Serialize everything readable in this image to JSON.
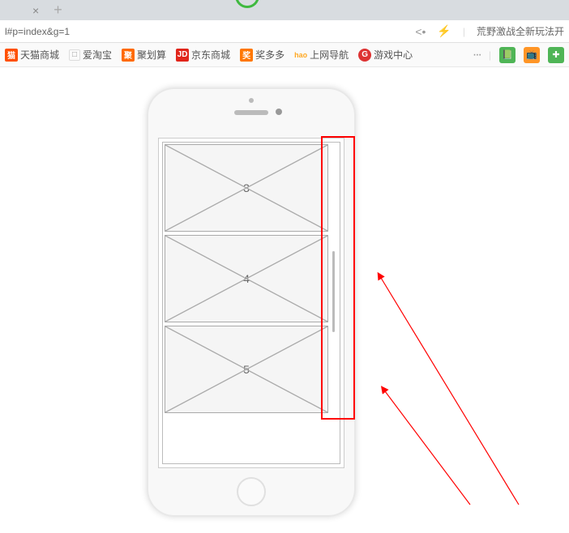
{
  "tab": {
    "close": "×",
    "new": "+"
  },
  "url": {
    "text": "l#p=index&g=1",
    "news": "荒野激战全新玩法开"
  },
  "bookmarks": {
    "items": [
      {
        "icon": "天",
        "label": "天猫商城"
      },
      {
        "icon": "淘",
        "label": "爱淘宝"
      },
      {
        "icon": "聚",
        "label": "聚划算"
      },
      {
        "icon": "JD",
        "label": "京东商城"
      },
      {
        "icon": "奖",
        "label": "奖多多"
      },
      {
        "icon": "hao",
        "label": "上网导航"
      },
      {
        "icon": "G",
        "label": "游戏中心"
      }
    ]
  },
  "wireframe": {
    "items": [
      "3",
      "4",
      "5"
    ]
  }
}
